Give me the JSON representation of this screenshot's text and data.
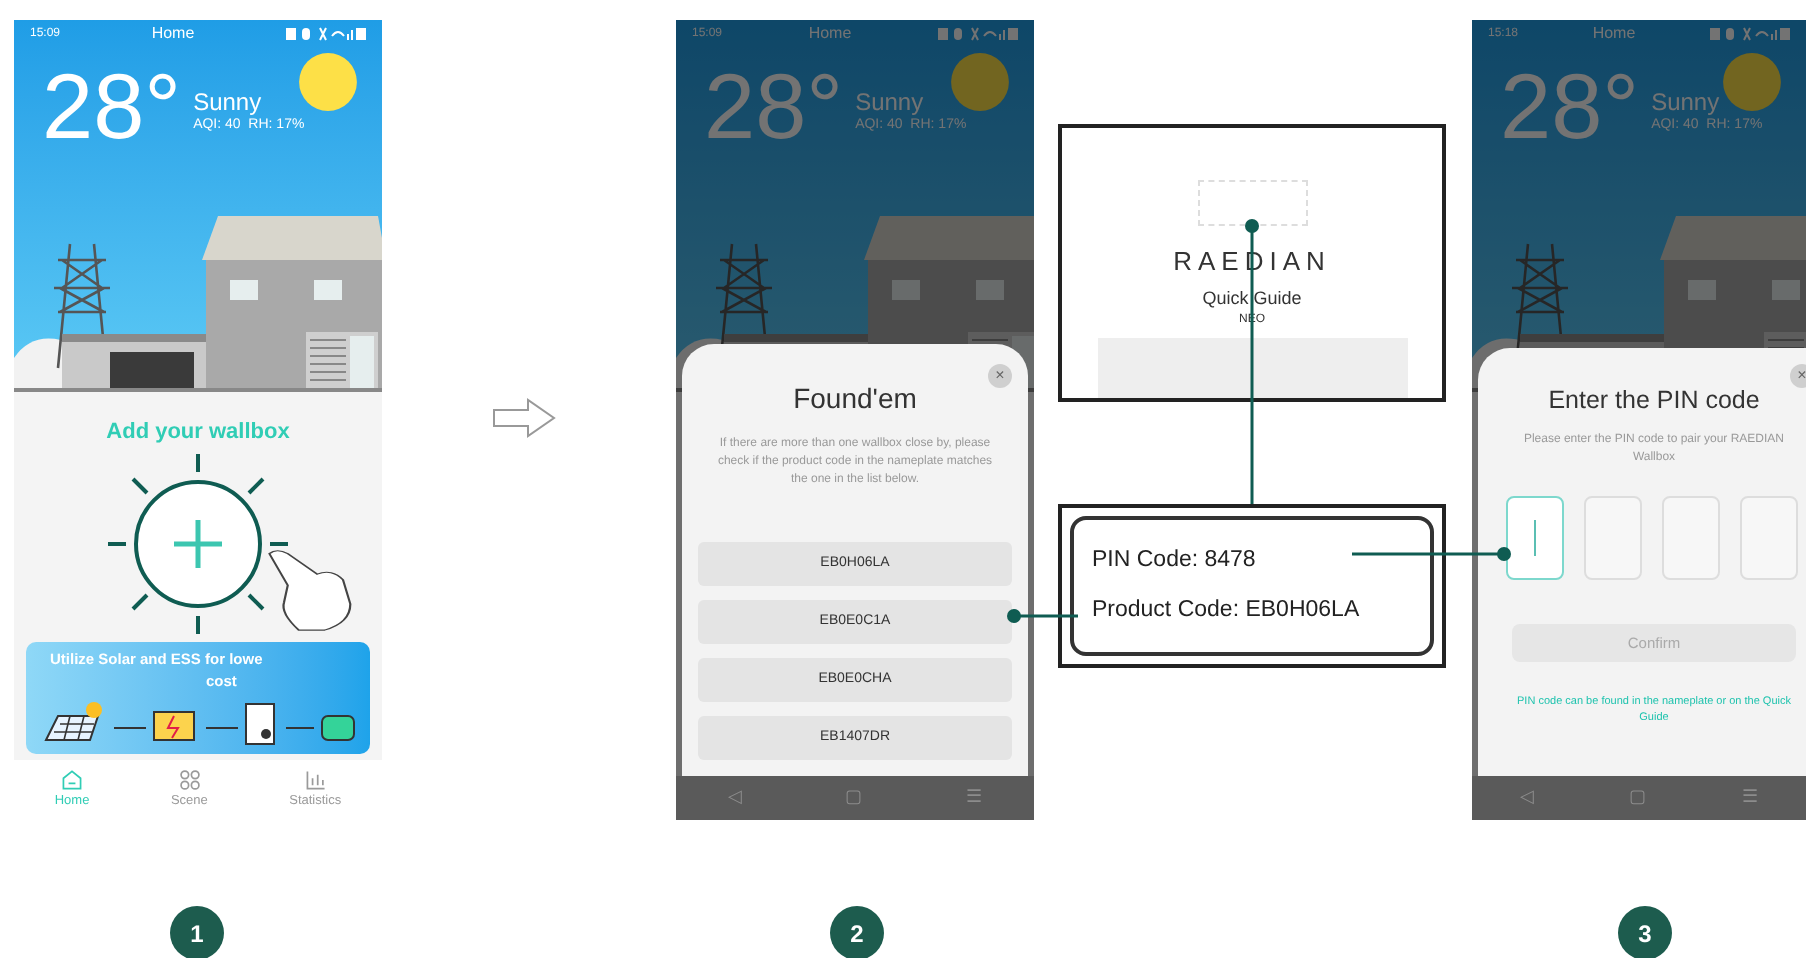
{
  "phones": [
    {
      "kind": "home",
      "status_time": "15:09",
      "title": "Home",
      "temperature": "28°",
      "condition": "Sunny",
      "air": "AQI: 40  RH: 17%",
      "heading": "Add your wallbox",
      "banner_lines": [
        "Utilize Solar and ESS for lowe",
        "cost"
      ],
      "nav": [
        {
          "label": "Home",
          "selected": true
        },
        {
          "label": "Scene",
          "selected": false
        },
        {
          "label": "Statistics",
          "selected": false
        }
      ]
    },
    {
      "kind": "found",
      "status_time": "15:09",
      "title": "Home",
      "temperature": "28°",
      "condition": "Sunny",
      "air": "AQI: 40  RH: 17%",
      "sheet": {
        "close": "×",
        "title": "Found'em",
        "text": "If there are more than one wallbox close by, please check if the product code in the nameplate matches the one in the list below.",
        "codes": [
          "EB0H06LA",
          "EB0E0C1A",
          "EB0E0CHA",
          "EB1407DR"
        ]
      },
      "system_nav": [
        "◁",
        "▢",
        "☰"
      ]
    },
    {
      "kind": "pin",
      "status_time": "15:18",
      "title": "Home",
      "temperature": "28°",
      "condition": "Sunny",
      "air": "AQI: 40  RH: 17%",
      "sheet": {
        "close": "×",
        "title": "Enter the PIN code",
        "text": "Please enter the PIN code to pair your RAEDIAN Wallbox",
        "pin_boxes": [
          {
            "focused": true
          },
          {
            "focused": false
          },
          {
            "focused": false
          },
          {
            "focused": false
          }
        ],
        "button": {
          "label": "Confirm",
          "disabled": true
        },
        "hint": "PIN code can be found in the nameplate or on the Quick Guide"
      },
      "system_nav": [
        "◁",
        "▢",
        "☰"
      ]
    }
  ],
  "quick_guide": {
    "brand": "RAEDIAN",
    "title": "Quick Guide",
    "model": "NEO"
  },
  "nameplate": {
    "lines": [
      "PIN Code: 8478",
      "Product Code: EB0H06LA"
    ]
  },
  "steps": [
    "1",
    "2",
    "3"
  ]
}
